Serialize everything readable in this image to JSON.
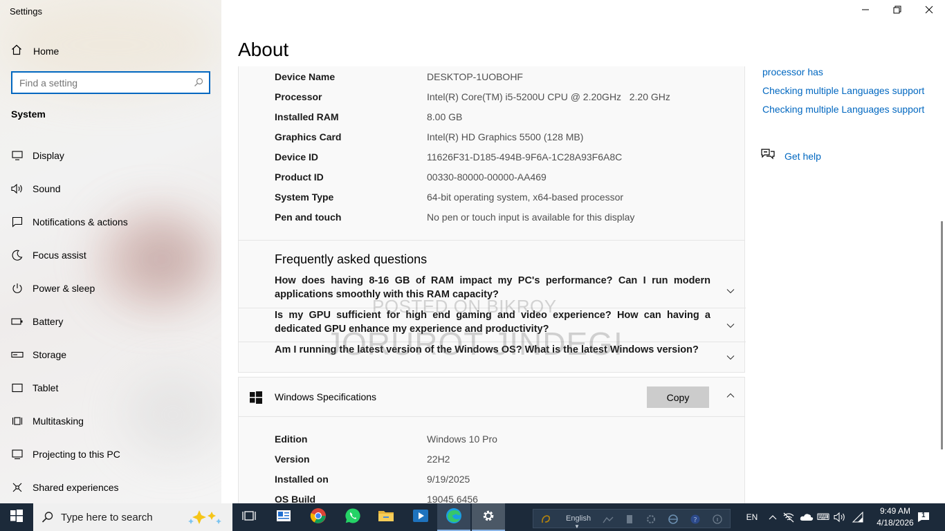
{
  "app": {
    "title": "Settings"
  },
  "sidebar": {
    "home": "Home",
    "search_placeholder": "Find a setting",
    "section": "System",
    "items": [
      {
        "label": "Display",
        "icon": "display-icon"
      },
      {
        "label": "Sound",
        "icon": "sound-icon"
      },
      {
        "label": "Notifications & actions",
        "icon": "notifications-icon"
      },
      {
        "label": "Focus assist",
        "icon": "focus-assist-icon"
      },
      {
        "label": "Power & sleep",
        "icon": "power-icon"
      },
      {
        "label": "Battery",
        "icon": "battery-icon"
      },
      {
        "label": "Storage",
        "icon": "storage-icon"
      },
      {
        "label": "Tablet",
        "icon": "tablet-icon"
      },
      {
        "label": "Multitasking",
        "icon": "multitasking-icon"
      },
      {
        "label": "Projecting to this PC",
        "icon": "projecting-icon"
      },
      {
        "label": "Shared experiences",
        "icon": "shared-experiences-icon"
      }
    ]
  },
  "main": {
    "title": "About",
    "device_specs": [
      {
        "key": "Device Name",
        "value": "DESKTOP-1UOBOHF"
      },
      {
        "key": "Processor",
        "value": "Intel(R) Core(TM) i5-5200U CPU @ 2.20GHz   2.20 GHz"
      },
      {
        "key": "Installed RAM",
        "value": "8.00 GB"
      },
      {
        "key": "Graphics Card",
        "value": "Intel(R) HD Graphics 5500 (128 MB)"
      },
      {
        "key": "Device ID",
        "value": "11626F31-D185-494B-9F6A-1C28A93F6A8C"
      },
      {
        "key": "Product ID",
        "value": "00330-80000-00000-AA469"
      },
      {
        "key": "System Type",
        "value": "64-bit operating system, x64-based processor"
      },
      {
        "key": "Pen and touch",
        "value": "No pen or touch input is available for this display"
      }
    ],
    "faq": {
      "title": "Frequently asked questions",
      "questions": [
        "How does having 8-16 GB of RAM impact my PC's performance? Can I run modern applications smoothly with this RAM capacity?",
        "Is my GPU sufficient for high end gaming and video experience? How can having a dedicated GPU enhance my experience and productivity?",
        "Am I running the latest version of the Windows OS? What is the latest Windows version?"
      ]
    },
    "windows_specs": {
      "title": "Windows Specifications",
      "copy_label": "Copy",
      "rows": [
        {
          "key": "Edition",
          "value": "Windows 10 Pro"
        },
        {
          "key": "Version",
          "value": "22H2"
        },
        {
          "key": "Installed on",
          "value": "9/19/2025"
        },
        {
          "key": "OS Build",
          "value": "19045.6456"
        }
      ]
    }
  },
  "related": {
    "links": [
      "processor has",
      "Checking multiple Languages support",
      "Checking multiple Languages support"
    ],
    "get_help": "Get help"
  },
  "watermark": {
    "line1": "POSTED ON BIKROY",
    "line2": "JORUROT JINDEGI"
  },
  "taskbar": {
    "search_placeholder": "Type here to search",
    "language_widget": "English",
    "input_lang": "EN",
    "time": "9:49 AM",
    "date": "4/18/2026",
    "notification_count": "1"
  },
  "colors": {
    "accent": "#0067c0",
    "taskbar": "#1c2a3a",
    "sidebar": "#f2f2f2"
  }
}
